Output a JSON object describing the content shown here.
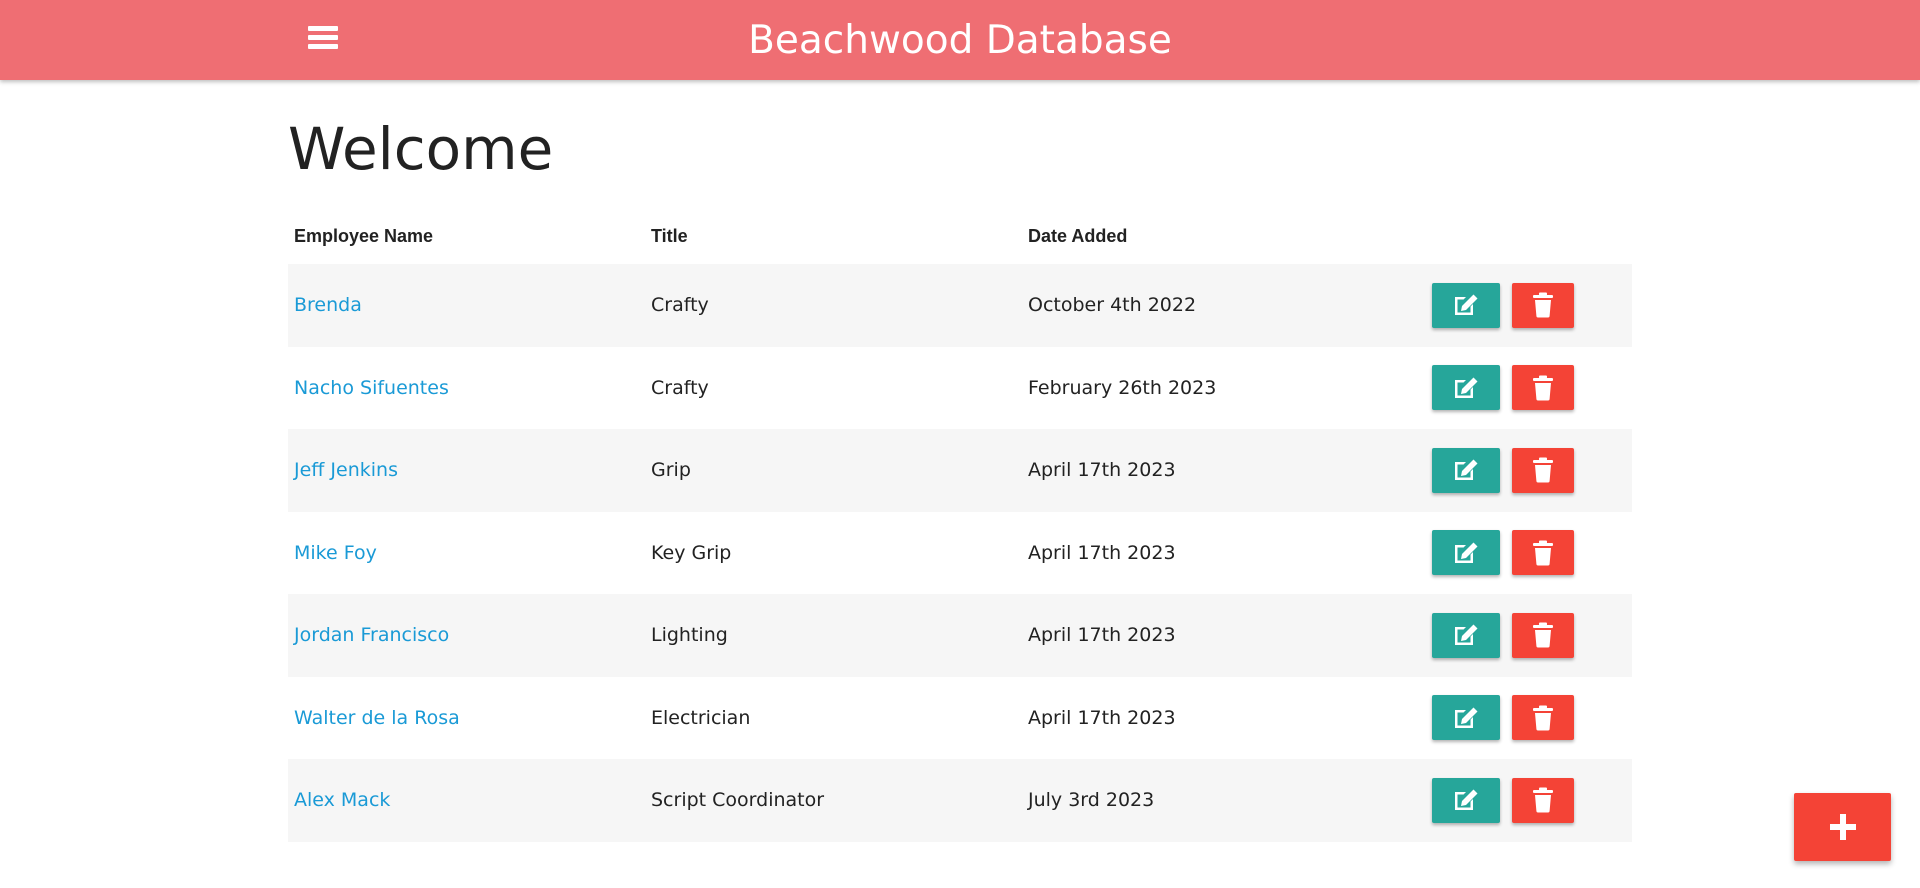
{
  "app": {
    "title": "Beachwood Database",
    "accent_color": "#ef6e73"
  },
  "header": {
    "menu_icon": "hamburger-menu-icon"
  },
  "page": {
    "heading": "Welcome"
  },
  "table": {
    "columns": [
      "Employee Name",
      "Title",
      "Date Added"
    ],
    "rows": [
      {
        "name": "Brenda",
        "title": "Crafty",
        "date": "October 4th 2022"
      },
      {
        "name": "Nacho Sifuentes",
        "title": "Crafty",
        "date": "February 26th 2023"
      },
      {
        "name": "Jeff Jenkins",
        "title": "Grip",
        "date": "April 17th 2023"
      },
      {
        "name": "Mike Foy",
        "title": "Key Grip",
        "date": "April 17th 2023"
      },
      {
        "name": "Jordan Francisco",
        "title": "Lighting",
        "date": "April 17th 2023"
      },
      {
        "name": "Walter de la Rosa",
        "title": "Electrician",
        "date": "April 17th 2023"
      },
      {
        "name": "Alex Mack",
        "title": "Script Coordinator",
        "date": "July 3rd 2023"
      }
    ],
    "row_actions": {
      "edit_icon": "pencil-edit-icon",
      "delete_icon": "trash-icon",
      "edit_color": "#26a69a",
      "delete_color": "#f44336"
    }
  },
  "fab": {
    "icon": "plus-icon",
    "color": "#f44336"
  },
  "colors": {
    "link": "#1a9ad6",
    "row_stripe": "#f6f6f6"
  }
}
